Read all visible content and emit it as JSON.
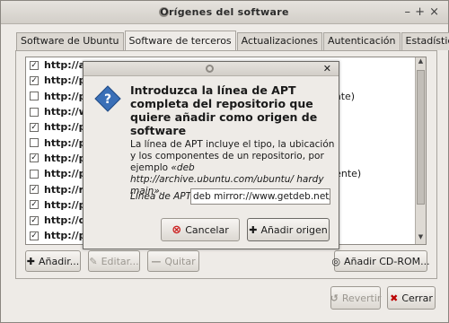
{
  "window": {
    "title": "Orígenes del software",
    "controls": [
      "–",
      "+",
      "×"
    ]
  },
  "tabs": [
    {
      "label": "Software de Ubuntu"
    },
    {
      "label": "Software de terceros"
    },
    {
      "label": "Actualizaciones"
    },
    {
      "label": "Autenticación"
    },
    {
      "label": "Estadísticas"
    }
  ],
  "list": {
    "rows": [
      {
        "checked": true,
        "text": "http://ar",
        "tail": ""
      },
      {
        "checked": true,
        "text": "http://pp",
        "tail": ""
      },
      {
        "checked": false,
        "text": "http://pp",
        "tail": "uente)"
      },
      {
        "checked": false,
        "text": "http://ww",
        "tail": ""
      },
      {
        "checked": true,
        "text": "http://pp",
        "tail": ""
      },
      {
        "checked": false,
        "text": "http://pp",
        "tail": "ente)"
      },
      {
        "checked": true,
        "text": "http://pp",
        "tail": ""
      },
      {
        "checked": false,
        "text": "http://pp",
        "tail": "digo fuente)"
      },
      {
        "checked": true,
        "text": "http://re",
        "tail": ""
      },
      {
        "checked": true,
        "text": "http://pp",
        "tail": ""
      },
      {
        "checked": true,
        "text": "http://de",
        "tail": ""
      },
      {
        "checked": true,
        "text": "http://pp",
        "tail": ""
      }
    ]
  },
  "buttons": {
    "add": "Añadir...",
    "edit": "Editar...",
    "remove": "Quitar",
    "add_cdrom": "Añadir CD-ROM...",
    "revert": "Revertir",
    "close": "Cerrar"
  },
  "dialog": {
    "heading": "Introduzca la línea de APT completa del repositorio que quiere añadir como origen de software",
    "body_plain": "La línea de APT incluye el tipo, la ubicación y los componentes de un repositorio, por ejemplo",
    "body_example": "«deb http://archive.ubuntu.com/ubuntu/ hardy main».",
    "apt_label": "Línea de APT:",
    "apt_value": "deb mirror://www.getdeb.net/play",
    "cancel": "Cancelar",
    "add_source": "Añadir origen"
  },
  "colors": {
    "question_icon": "#3a6fb7",
    "cancel_icon": "#cc2020"
  }
}
